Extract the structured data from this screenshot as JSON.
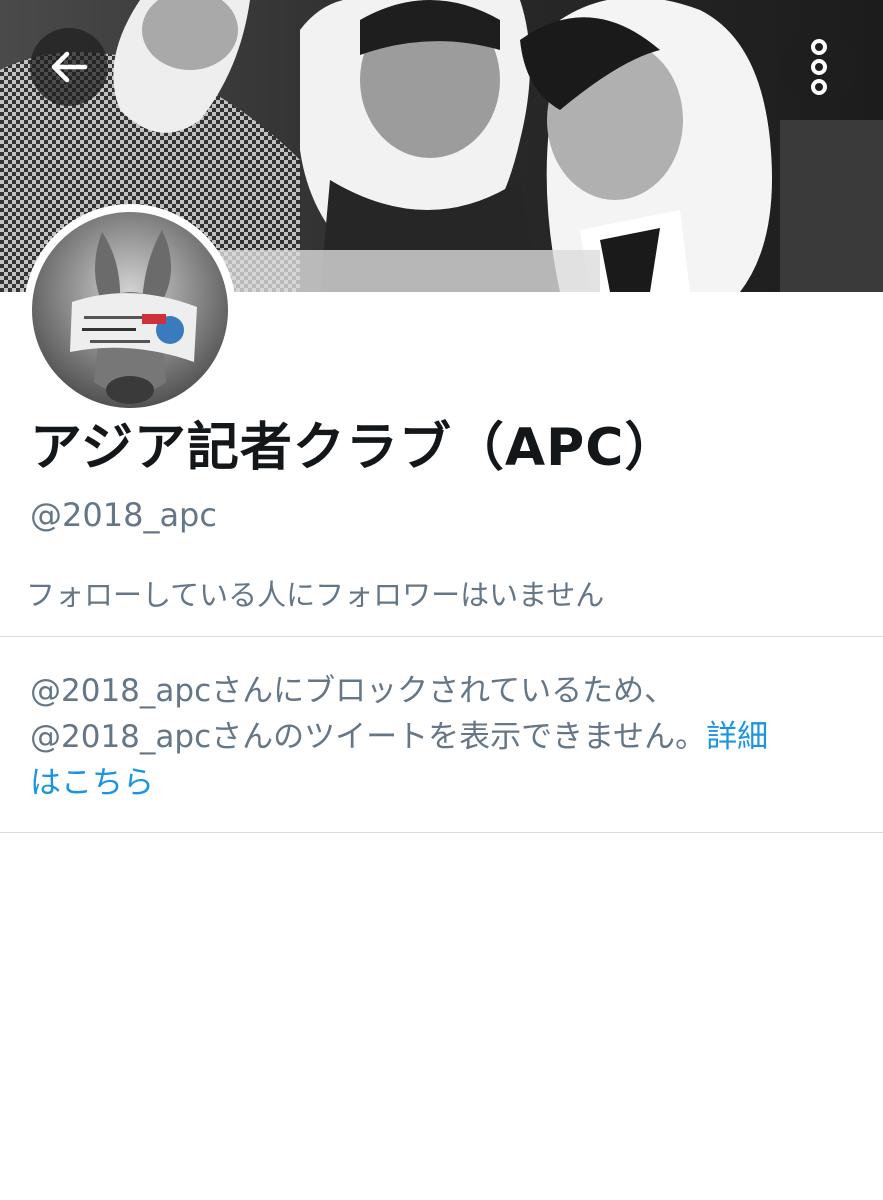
{
  "header": {
    "back_icon": "arrow-left-icon",
    "more_icon": "vertical-ellipsis-icon",
    "banner_description_hidden": true
  },
  "profile": {
    "display_name": "アジア記者クラブ（APC）",
    "handle": "@2018_apc",
    "follow_note": "フォローしている人にフォロワーはいません"
  },
  "blocked": {
    "line1": "@2018_apcさんにブロックされているため、",
    "line2": "@2018_apcさんのツイートを表示できません。",
    "learn_more_part1": "詳細",
    "learn_more_part2": "はこちら"
  },
  "colors": {
    "text_primary": "#14171a",
    "text_secondary": "#657786",
    "link": "#1b95e0",
    "divider": "#d9dde0"
  }
}
